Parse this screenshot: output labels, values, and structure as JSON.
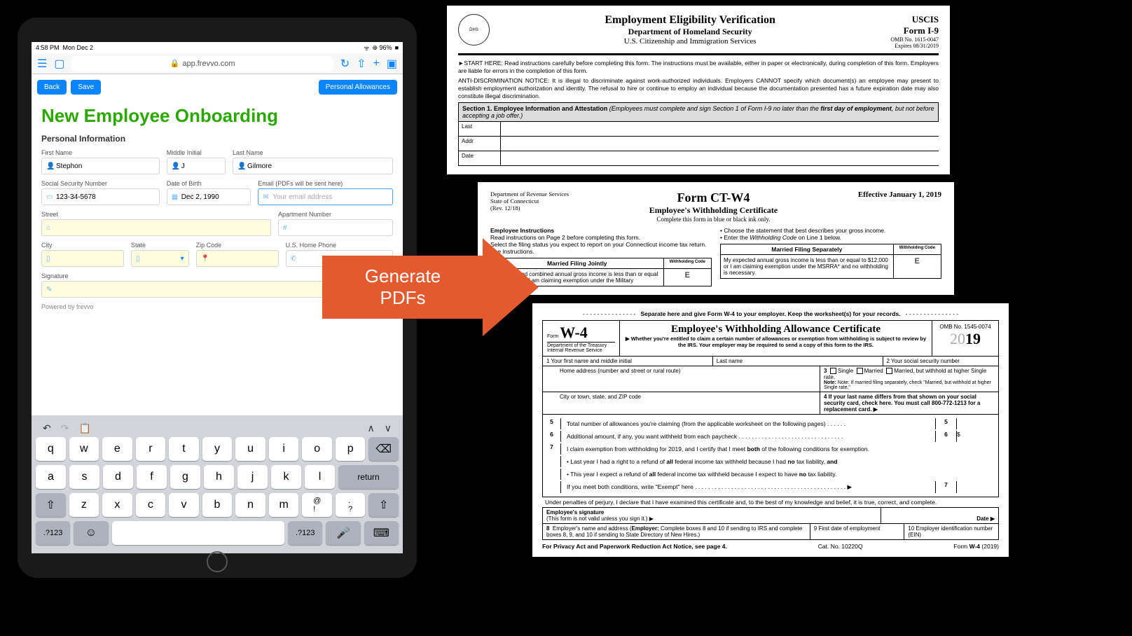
{
  "ipad": {
    "status": {
      "time": "4:58 PM",
      "date": "Mon Dec 2",
      "battery": "96%"
    },
    "browser": {
      "url": "app.frevvo.com"
    },
    "buttons": {
      "back": "Back",
      "save": "Save",
      "allowances": "Personal Allowances"
    },
    "form": {
      "title": "New Employee Onboarding",
      "section": "Personal Information",
      "fields": {
        "firstName": {
          "label": "First Name",
          "value": "Stephon"
        },
        "middleInitial": {
          "label": "Middle Initial",
          "value": "J"
        },
        "lastName": {
          "label": "Last Name",
          "value": "Gilmore"
        },
        "ssn": {
          "label": "Social Security Number",
          "value": "123-34-5678"
        },
        "dob": {
          "label": "Date of Birth",
          "value": "Dec 2, 1990"
        },
        "email": {
          "label": "Email (PDFs will be sent here)",
          "placeholder": "Your email address"
        },
        "street": {
          "label": "Street"
        },
        "apt": {
          "label": "Apartment Number"
        },
        "city": {
          "label": "City"
        },
        "state": {
          "label": "State"
        },
        "zip": {
          "label": "Zip Code"
        },
        "phone": {
          "label": "U.S. Home Phone"
        },
        "signature": {
          "label": "Signature"
        }
      },
      "powered": "Powered by frevvo"
    },
    "keyboard": {
      "row1": [
        "q",
        "w",
        "e",
        "r",
        "t",
        "y",
        "u",
        "i",
        "o",
        "p",
        "⌫"
      ],
      "row2": [
        "a",
        "s",
        "d",
        "f",
        "g",
        "h",
        "j",
        "k",
        "l",
        "return"
      ],
      "row3": [
        "⇧",
        "z",
        "x",
        "c",
        "v",
        "b",
        "n",
        "m",
        "!",
        ".",
        "⇧"
      ],
      "row4": [
        ".?123",
        "☺",
        "",
        "",
        "🎤",
        "⌨"
      ]
    }
  },
  "arrow": {
    "line1": "Generate",
    "line2": "PDFs"
  },
  "i9": {
    "title1": "Employment Eligibility Verification",
    "title2": "Department of Homeland Security",
    "title3": "U.S. Citizenship and Immigration Services",
    "right1": "USCIS",
    "right2": "Form I-9",
    "right3": "OMB No. 1615-0047",
    "right4": "Expires 08/31/2019",
    "start": "►START HERE: Read instructions carefully before completing this form. The instructions must be available, either in paper or electronically, during completion of this form. Employers are liable for errors in the completion of this form.",
    "anti": "ANTI-DISCRIMINATION NOTICE: It is illegal to discriminate against work-authorized individuals. Employers CANNOT specify which document(s) an employee may present to establish employment authorization and identity. The refusal to hire or continue to employ an individual because the documentation presented has a future expiration date may also constitute illegal discrimination.",
    "section1": "Section 1. Employee Information and Attestation (Employees must complete and sign Section 1 of Form I-9 no later than the first day of employment, but not before accepting a job offer.)",
    "cells": {
      "last": "Last",
      "addr": "Addr",
      "date": "Date"
    }
  },
  "ctw4": {
    "dept": "Department of Revenue Services\nState of Connecticut\n(Rev. 12/18)",
    "title1": "Form CT-W4",
    "title2": "Employee's Withholding Certificate",
    "title3": "Complete this form in blue or black ink only.",
    "effective": "Effective January 1, 2019",
    "instr_h": "Employee Instructions",
    "instr1": "Read instructions on Page 2 before completing this form.",
    "instr2": "Select the filing status you expect to report on your Connecticut income tax return. See instructions.",
    "bullet1": "Choose the statement that best describes your gross income.",
    "bullet2": "Enter the Withholding Code on Line 1 below.",
    "mfj": "Married Filing Jointly",
    "mfj_text": "Our expected combined annual gross income is less than or equal to $24,000 or I am claiming exemption under the Military",
    "mfj_codeh": "Withholding Code",
    "mfj_code": "E",
    "mfs": "Married Filing Separately",
    "mfs_text": "My expected annual gross income is less than or equal to $12,000 or I am claiming exemption under the MSRRA* and no withholding is necessary.",
    "mfs_codeh": "Withholding Code",
    "mfs_code": "E"
  },
  "w4": {
    "separate": "Separate here and give Form W-4 to your employer. Keep the worksheet(s) for your records.",
    "form_label": "Form",
    "form_name": "W-4",
    "dept": "Department of the Treasury\nInternal Revenue Service",
    "title": "Employee's Withholding Allowance Certificate",
    "sub": "▶ Whether you're entitled to claim a certain number of allowances or exemption from withholding is subject to review by the IRS. Your employer may be required to send a copy of this form to the IRS.",
    "omb": "OMB No. 1545-0074",
    "year": "2019",
    "r1_1": "1   Your first name and middle initial",
    "r1_2": "Last name",
    "r1_3": "2  Your social security number",
    "r2_1": "Home address (number and street or rural route)",
    "r2_3a": "3",
    "r2_3b": "Single",
    "r2_3c": "Married",
    "r2_3d": "Married, but withhold at higher Single rate.",
    "r2_note": "Note: If married filing separately, check \"Married, but withhold at higher Single rate.\"",
    "r3_1": "City or town, state, and ZIP code",
    "r3_4": "4  If your last name differs from that shown on your social security card, check here. You must call 800-772-1213 for a replacement card. ▶",
    "l5": "Total number of allowances you're claiming (from the applicable worksheet on the following pages) . . . . . .",
    "l5n": "5",
    "l6": "Additional amount, if any, you want withheld from each paycheck . . . . . . . . . . . . . . . . . . . . . . . . . . . . . . . .",
    "l6n": "6",
    "l6s": "$",
    "l7": "I claim exemption from withholding for 2019, and I certify that I meet both of the following conditions for exemption.",
    "l7n": "7",
    "l7a": "• Last year I had a right to a refund of all federal income tax withheld because I had no tax liability, and",
    "l7b": "• This year I expect a refund of all federal income tax withheld because I expect to have no tax liability.",
    "l7c": "If you meet both conditions, write \"Exempt\" here . . . . . . . . . . . . . . . . . . . . . . . . . . . . . . . . . . . . . . . . . . . . . . ▶",
    "l7box": "7",
    "penalty": "Under penalties of perjury, I declare that I have examined this certificate and, to the best of my knowledge and belief, it is true, correct, and complete.",
    "sig_h": "Employee's signature",
    "sig_note": "(This form is not valid unless you sign it.) ▶",
    "date": "Date ▶",
    "l8": "8   Employer's name and address (Employer: Complete boxes 8 and 10 if sending to IRS and complete boxes 8, 9, and 10 if sending to State Directory of New Hires.)",
    "l9": "9  First date of employment",
    "l10": "10  Employer identification number (EIN)",
    "footer1": "For Privacy Act and Paperwork Reduction Act Notice, see page 4.",
    "footer2": "Cat. No. 10220Q",
    "footer3": "Form W-4 (2019)"
  }
}
